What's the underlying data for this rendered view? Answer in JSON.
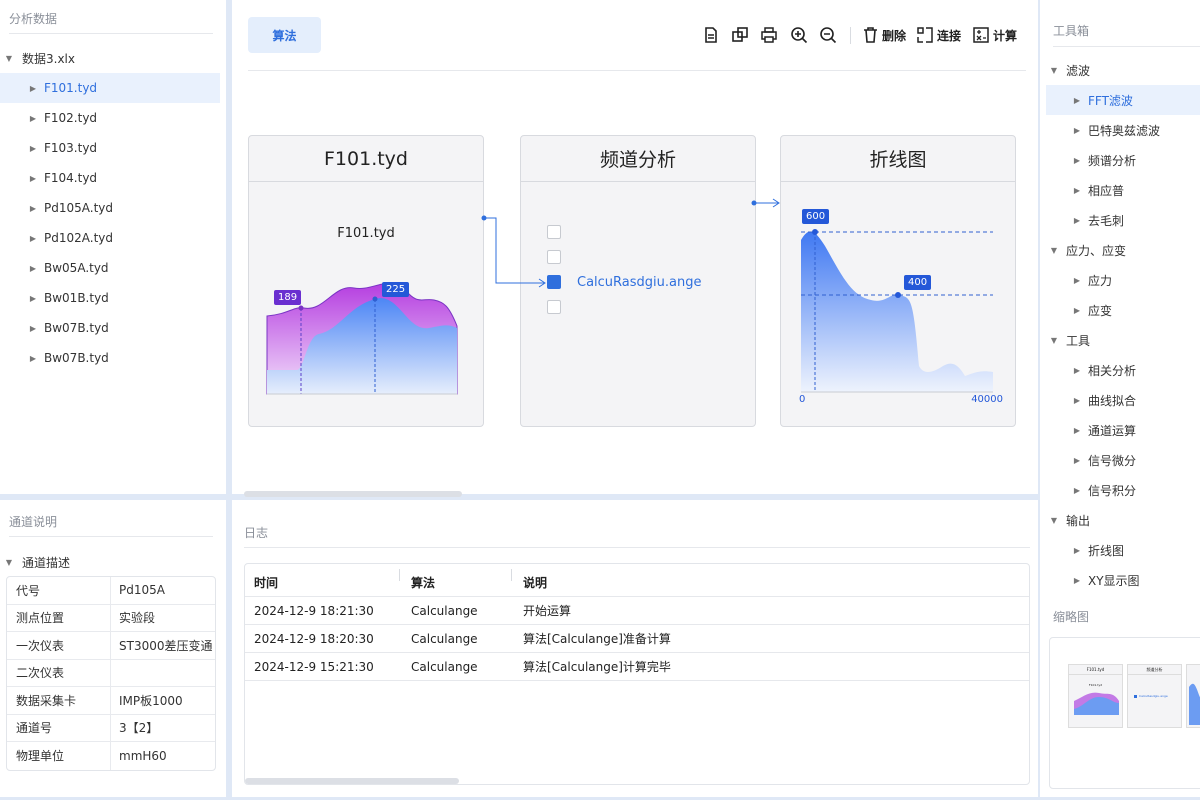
{
  "left_panel": {
    "title": "分析数据",
    "root": "数据3.xlx",
    "files": [
      "F101.tyd",
      "F102.tyd",
      "F103.tyd",
      "F104.tyd",
      "Pd105A.tyd",
      "Pd102A.tyd",
      "Bw05A.tyd",
      "Bw01B.tyd",
      "Bw07B.tyd",
      "Bw07B.tyd"
    ],
    "selected_index": 0
  },
  "channel_panel": {
    "title": "通道说明",
    "group": "通道描述",
    "rows": [
      {
        "key": "代号",
        "value": "Pd105A"
      },
      {
        "key": "测点位置",
        "value": "实验段"
      },
      {
        "key": "一次仪表",
        "value": "ST3000差压变通"
      },
      {
        "key": "二次仪表",
        "value": ""
      },
      {
        "key": "数据采集卡",
        "value": "IMP板1000"
      },
      {
        "key": "通道号",
        "value": "3【2】"
      },
      {
        "key": "物理单位",
        "value": "mmH60"
      }
    ]
  },
  "toolbar": {
    "algo_label": "算法",
    "delete_label": "删除",
    "connect_label": "连接",
    "compute_label": "计算"
  },
  "canvas": {
    "card1": {
      "title": "F101.tyd",
      "subtitle": "F101.tyd",
      "label_a": "189",
      "label_b": "225"
    },
    "card2": {
      "title": "频道分析",
      "item": "CalcuRasdgiu.ange",
      "checked": [
        false,
        false,
        true,
        false
      ]
    },
    "card3": {
      "title": "折线图",
      "label_a": "600",
      "label_b": "400",
      "x_min": "0",
      "x_max": "40000"
    }
  },
  "log": {
    "title": "日志",
    "columns": [
      "时间",
      "算法",
      "说明"
    ],
    "rows": [
      [
        "2024-12-9 18:21:30",
        "Calculange",
        "开始运算"
      ],
      [
        "2024-12-9 18:20:30",
        "Calculange",
        "算法[Calculange]准备计算"
      ],
      [
        "2024-12-9 15:21:30",
        "Calculange",
        "算法[Calculange]计算完毕"
      ]
    ]
  },
  "toolbox": {
    "title": "工具箱",
    "groups": [
      {
        "name": "滤波",
        "items": [
          "FFT滤波",
          "巴特奥兹滤波",
          "频谱分析",
          "相应普",
          "去毛刺"
        ]
      },
      {
        "name": "应力、应变",
        "items": [
          "应力",
          "应变"
        ]
      },
      {
        "name": "工具",
        "items": [
          "相关分析",
          "曲线拟合",
          "通道运算",
          "信号微分",
          "信号积分"
        ]
      },
      {
        "name": "输出",
        "items": [
          "折线图",
          "XY显示图"
        ]
      }
    ],
    "selected": "FFT滤波",
    "thumbnail_title": "缩略图",
    "thumb_card1": "F101.tyd",
    "thumb_card2": "频道分析",
    "thumb_card1_sub": "F101.tyd",
    "thumb_card2_item": "CalcuRasdgiu.ange"
  },
  "colors": {
    "accent": "#2f6fdd",
    "selected_bg": "#e9f1fd",
    "purple": "#a24ad8",
    "blue": "#3b82f6"
  }
}
